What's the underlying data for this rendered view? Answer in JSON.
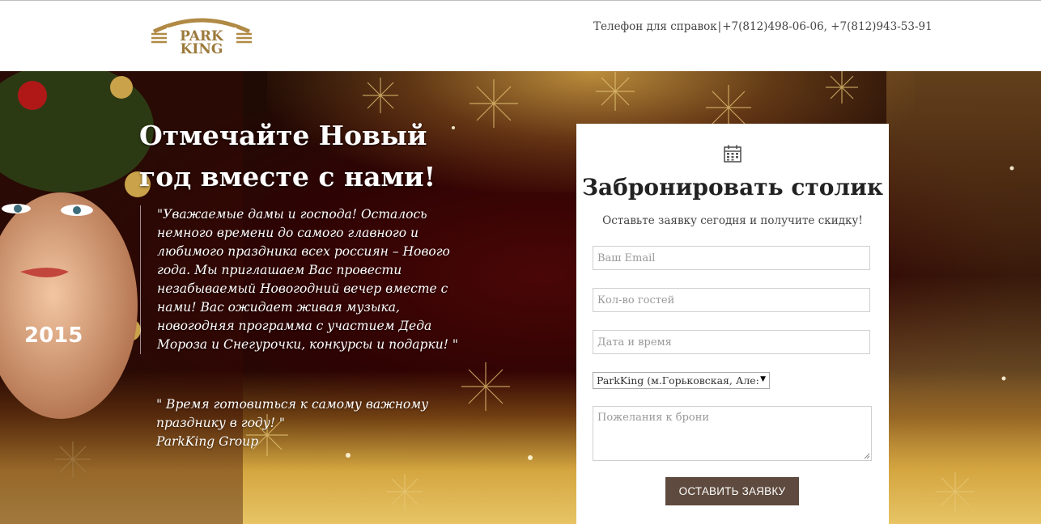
{
  "header": {
    "logo_alt": "PARK KING",
    "phone_label": "Телефон для справок",
    "phone_separator": "|",
    "phone_numbers": "+7(812)498-06-06, +7(812)943-53-91"
  },
  "hero": {
    "headline_line1": "Отмечайте Новый",
    "headline_line2": "год вместе с нами!",
    "quote_text": "\"Уважаемые дамы и господа! Осталось немного времени до самого главного и любимого праздника всех россиян – Нового года. Мы приглашаем Вас провести незабываемый Новогодний вечер вместе с нами! Вас ожидает живая музыка, новогодняя программа с участием Деда Мороза и Снегурочки, конкурсы и подарки! \"",
    "tagline": "\" Время готовиться к самому важному празднику в году! \"",
    "signature": "ParkKing Group"
  },
  "form": {
    "icon": "calendar-icon",
    "title": "Забронировать столик",
    "subtitle": "Оставьте заявку сегодня и получите скидку!",
    "email_placeholder": "Ваш Email",
    "guests_placeholder": "Кол-во гостей",
    "datetime_placeholder": "Дата и время",
    "location_selected": "ParkKing (м.Горьковская, Але:",
    "wishes_placeholder": "Пожелания к брони",
    "submit_label": "ОСТАВИТЬ ЗАЯВКУ"
  },
  "colors": {
    "button": "#5e4a3e",
    "dark_red": "#2e0303",
    "gold": "#d4a640"
  }
}
